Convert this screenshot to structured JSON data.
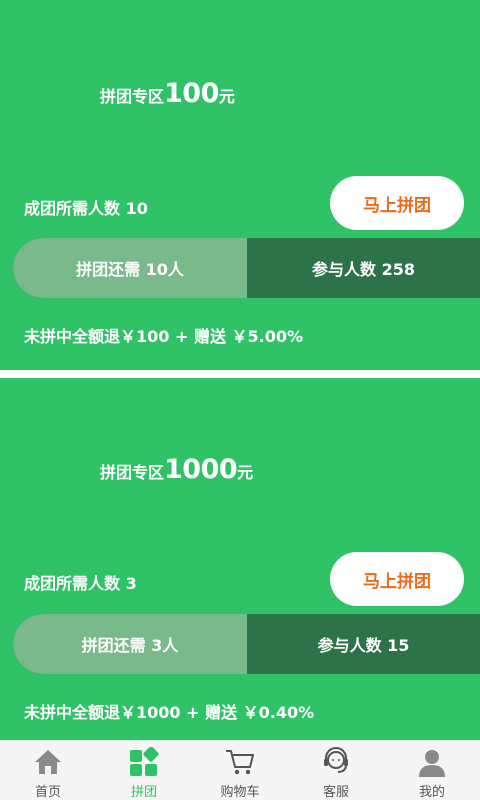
{
  "groups": [
    {
      "title_label": "拼团专区",
      "title_amount": "100",
      "title_unit": "元",
      "need_text": "成团所需人数 10",
      "join_button": "马上拼团",
      "remaining": "拼团还需 10人",
      "participants": "参与人数 258",
      "refund": "未拼中全额退￥100 + 赠送 ￥5.00%",
      "progress": 0.5
    },
    {
      "title_label": "拼团专区",
      "title_amount": "1000",
      "title_unit": "元",
      "need_text": "成团所需人数 3",
      "join_button": "马上拼团",
      "remaining": "拼团还需 3人",
      "participants": "参与人数 15",
      "refund": "未拼中全额退￥1000 + 赠送 ￥0.40%",
      "progress": 0.5
    }
  ],
  "tabbar": {
    "items": [
      {
        "label": "首页",
        "icon": "home-icon",
        "active": false
      },
      {
        "label": "拼团",
        "icon": "grid-icon",
        "active": true
      },
      {
        "label": "购物车",
        "icon": "cart-icon",
        "active": false
      },
      {
        "label": "客服",
        "icon": "headset-icon",
        "active": false
      },
      {
        "label": "我的",
        "icon": "user-icon",
        "active": false
      }
    ]
  },
  "colors": {
    "card_green": "#30c266",
    "progress_left": "#7ab98b",
    "progress_right": "#2d7249",
    "button_text": "#f06a1a",
    "tab_active": "#30c266"
  }
}
